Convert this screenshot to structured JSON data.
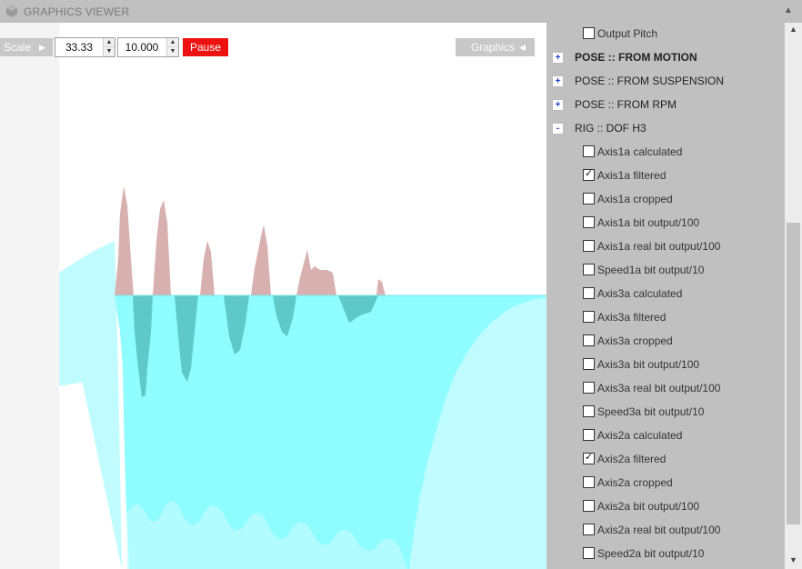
{
  "window": {
    "title": "GRAPHICS VIEWER",
    "collapse_icon": "triangle-up"
  },
  "toolbar": {
    "scale_label": "Scale",
    "scale_value": "33.33",
    "secondary_value": "10.000",
    "pause_label": "Pause",
    "graphics_label": "Graphics"
  },
  "colors": {
    "pause_bg": "#ee1111",
    "positive_fill": "#d8b0b0",
    "negative_fill": "#8ffcff",
    "dark_fill": "#5fc8c8",
    "light_fill": "#c0fcff"
  },
  "panel": {
    "rows": [
      {
        "kind": "check",
        "label": "Output Pitch",
        "checked": false
      },
      {
        "kind": "group",
        "label": "POSE :: FROM MOTION",
        "toggle": "+",
        "bold": true
      },
      {
        "kind": "group",
        "label": "POSE :: FROM SUSPENSION",
        "toggle": "+",
        "bold": false
      },
      {
        "kind": "group",
        "label": "POSE :: FROM RPM",
        "toggle": "+",
        "bold": false
      },
      {
        "kind": "group",
        "label": "RIG :: DOF H3",
        "toggle": "-",
        "bold": false
      },
      {
        "kind": "check",
        "label": "Axis1a calculated",
        "checked": false
      },
      {
        "kind": "check",
        "label": "Axis1a filtered",
        "checked": true
      },
      {
        "kind": "check",
        "label": "Axis1a cropped",
        "checked": false
      },
      {
        "kind": "check",
        "label": "Axis1a bit output/100",
        "checked": false
      },
      {
        "kind": "check",
        "label": "Axis1a real bit output/100",
        "checked": false
      },
      {
        "kind": "check",
        "label": "Speed1a bit output/10",
        "checked": false
      },
      {
        "kind": "check",
        "label": "Axis3a calculated",
        "checked": false
      },
      {
        "kind": "check",
        "label": "Axis3a filtered",
        "checked": false
      },
      {
        "kind": "check",
        "label": "Axis3a cropped",
        "checked": false
      },
      {
        "kind": "check",
        "label": "Axis3a bit output/100",
        "checked": false
      },
      {
        "kind": "check",
        "label": "Axis3a real bit output/100",
        "checked": false
      },
      {
        "kind": "check",
        "label": "Speed3a bit output/10",
        "checked": false
      },
      {
        "kind": "check",
        "label": "Axis2a calculated",
        "checked": false
      },
      {
        "kind": "check",
        "label": "Axis2a filtered",
        "checked": true
      },
      {
        "kind": "check",
        "label": "Axis2a cropped",
        "checked": false
      },
      {
        "kind": "check",
        "label": "Axis2a bit output/100",
        "checked": false
      },
      {
        "kind": "check",
        "label": "Axis2a real bit output/100",
        "checked": false
      },
      {
        "kind": "check",
        "label": "Speed2a bit output/10",
        "checked": false
      }
    ]
  }
}
